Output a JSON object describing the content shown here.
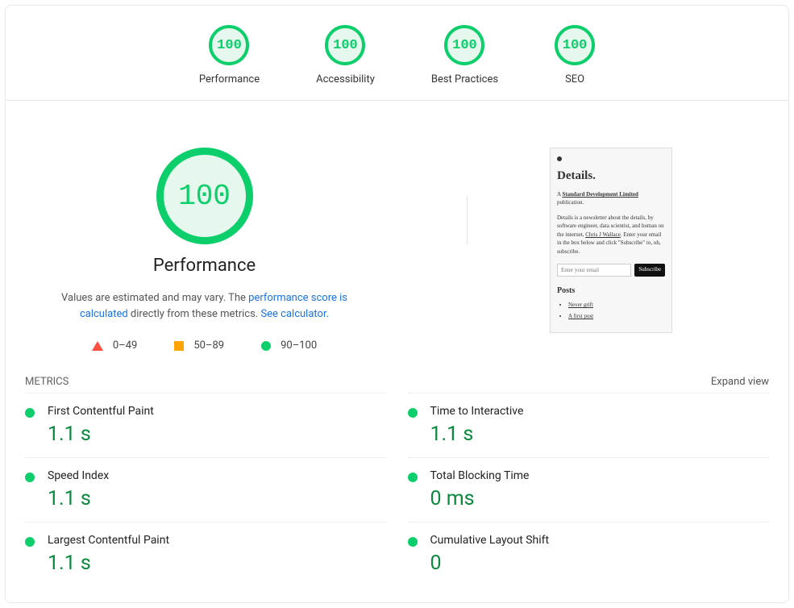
{
  "colors": {
    "good": "#0cce6b",
    "goodValue": "#0a8a3e",
    "average": "#ffa400",
    "poor": "#ff4e42"
  },
  "topScores": [
    {
      "name": "performance",
      "score": "100",
      "label": "Performance"
    },
    {
      "name": "accessibility",
      "score": "100",
      "label": "Accessibility"
    },
    {
      "name": "best-practices",
      "score": "100",
      "label": "Best Practices"
    },
    {
      "name": "seo",
      "score": "100",
      "label": "SEO"
    }
  ],
  "mainGauge": {
    "score": "100",
    "title": "Performance",
    "desc_prefix": "Values are estimated and may vary. The ",
    "link1": "performance score is calculated",
    "desc_mid": " directly from these metrics. ",
    "link2": "See calculator."
  },
  "legend": {
    "poor": "0–49",
    "average": "50–89",
    "good": "90–100"
  },
  "preview": {
    "title": "Details.",
    "sub_a": "A ",
    "sub_b": "Standard Development Limited",
    "sub_c": " publication.",
    "para_1": "Details is a newsletter about the details, by software engineer, data scientist, and human on the internet, ",
    "para_link": "Chris J Wallace",
    "para_2": ". Enter your email in the box below and click \"Subscribe\" to, uh, subscribe.",
    "placeholder": "Enter your email",
    "button": "Subscribe",
    "posts_heading": "Posts",
    "posts": [
      "Never grift",
      "A first post"
    ]
  },
  "metrics": {
    "heading": "METRICS",
    "expand": "Expand view",
    "left": [
      {
        "label": "First Contentful Paint",
        "value": "1.1 s"
      },
      {
        "label": "Speed Index",
        "value": "1.1 s"
      },
      {
        "label": "Largest Contentful Paint",
        "value": "1.1 s"
      }
    ],
    "right": [
      {
        "label": "Time to Interactive",
        "value": "1.1 s"
      },
      {
        "label": "Total Blocking Time",
        "value": "0 ms"
      },
      {
        "label": "Cumulative Layout Shift",
        "value": "0"
      }
    ]
  }
}
